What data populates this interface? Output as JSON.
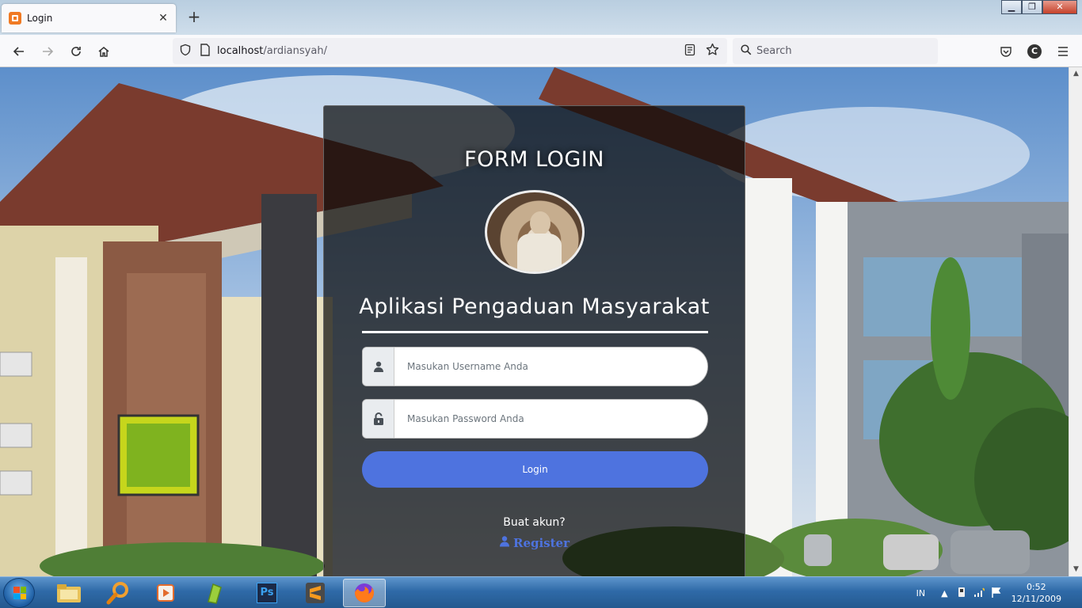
{
  "browser": {
    "tab_title": "Login",
    "url_host": "localhost",
    "url_path": "/ardiansyah/",
    "search_placeholder": "Search",
    "account_initial": "C"
  },
  "form": {
    "heading": "FORM LOGIN",
    "app_title": "Aplikasi Pengaduan Masyarakat",
    "username_placeholder": "Masukan Username Anda",
    "password_placeholder": "Masukan Password Anda",
    "login_label": "Login",
    "signup_prompt": "Buat akun?",
    "register_label": "Register",
    "accent_color": "#4e73df"
  },
  "taskbar": {
    "apps": [
      "file-explorer",
      "search",
      "media-player",
      "app-green",
      "photoshop",
      "sublime-text",
      "firefox"
    ],
    "photoshop_label": "Ps",
    "language": "IN",
    "time": "0:52",
    "date": "12/11/2009"
  }
}
